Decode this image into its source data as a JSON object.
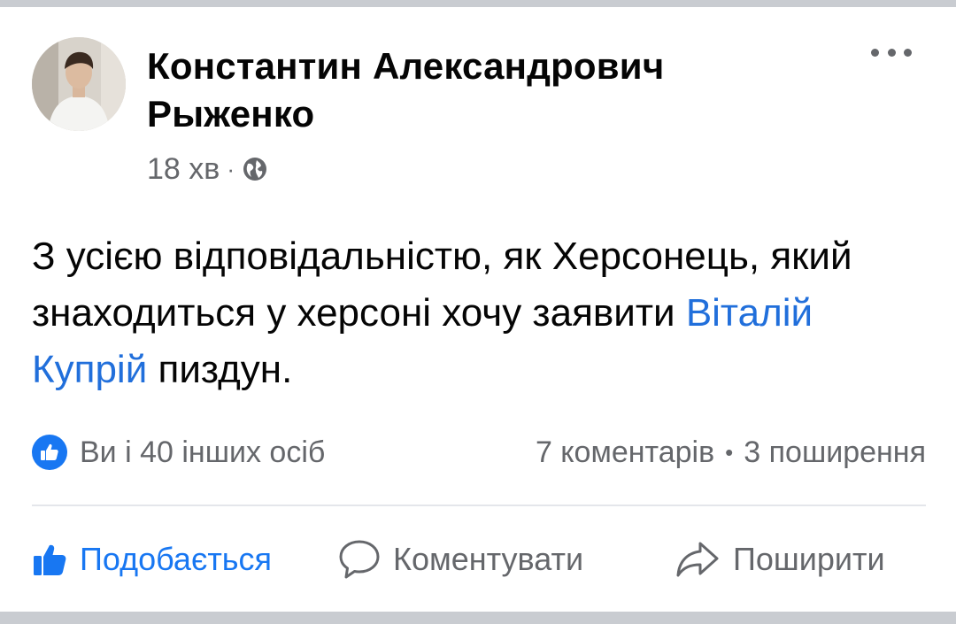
{
  "post": {
    "author_name": "Константин Александрович Рыженко",
    "time": "18 хв",
    "visibility_icon": "globe-icon",
    "text_before_mention": "З усією відповідальністю, як Херсонець, який знаходиться у херсоні хочу заявити ",
    "mention": "Віталій Купрій",
    "text_after_mention": " пиздун."
  },
  "stats": {
    "reactions": "Ви і 40 інших осіб",
    "comments": "7 коментарів",
    "shares": "3 поширення"
  },
  "actions": {
    "like_label": "Подобається",
    "comment_label": "Коментувати",
    "share_label": "Поширити"
  },
  "colors": {
    "link_blue": "#216fdb",
    "facebook_blue": "#1877f2",
    "secondary_text": "#65676b",
    "primary_text": "#050505"
  }
}
